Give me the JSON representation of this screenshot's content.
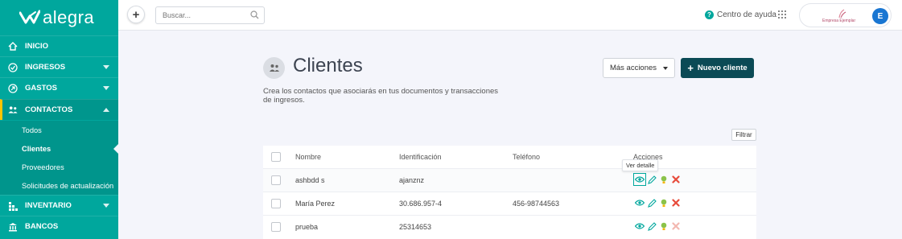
{
  "brand": {
    "name": "alegra"
  },
  "sidebar": {
    "items": [
      {
        "label": "INICIO",
        "icon": "home-icon"
      },
      {
        "label": "INGRESOS",
        "icon": "income-icon"
      },
      {
        "label": "GASTOS",
        "icon": "expenses-icon"
      },
      {
        "label": "CONTACTOS",
        "icon": "contacts-icon"
      },
      {
        "label": "INVENTARIO",
        "icon": "inventory-icon"
      },
      {
        "label": "BANCOS",
        "icon": "bank-icon"
      }
    ],
    "sub_items": [
      {
        "label": "Todos"
      },
      {
        "label": "Clientes"
      },
      {
        "label": "Proveedores"
      },
      {
        "label": "Solicitudes de actualización"
      }
    ]
  },
  "topbar": {
    "search_placeholder": "Buscar...",
    "help_label": "Centro de ayuda",
    "company_name": "Empresa Ejemplar",
    "avatar_initial": "E"
  },
  "page": {
    "title": "Clientes",
    "description": "Crea los contactos que asociarás en tus documentos y transacciones de ingresos.",
    "more_actions_label": "Más acciones",
    "new_client_label": "Nuevo cliente",
    "filter_label": "Filtrar"
  },
  "table": {
    "headers": [
      "Nombre",
      "Identificación",
      "Teléfono",
      "Acciones"
    ],
    "rows": [
      {
        "name": "ashbdd s",
        "id": "ajanznz",
        "phone": ""
      },
      {
        "name": "María Perez",
        "id": "30.686.957-4",
        "phone": "456-98744563"
      },
      {
        "name": "prueba",
        "id": "25314653",
        "phone": ""
      }
    ],
    "tooltip": "Ver detalle"
  },
  "colors": {
    "sidebar": "#00a79d",
    "primary_button": "#0b4a55",
    "accent": "#ffc400",
    "delete": "#e74c3c"
  }
}
